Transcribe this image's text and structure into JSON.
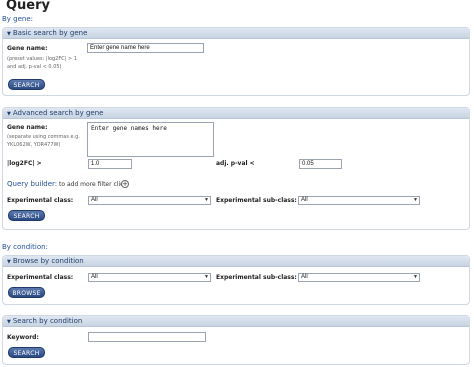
{
  "page_title": "Query",
  "by_gene_label": "By gene:",
  "by_condition_label": "By condition:",
  "basic": {
    "header": "Basic search by gene",
    "gene_name_label": "Gene name:",
    "hint": "(preset values: |log2FC| > 1 and adj. p-val < 0.05)",
    "gene_input_value": "Enter gene name here",
    "search_button": "SEARCH"
  },
  "advanced": {
    "header": "Advanced search by gene",
    "gene_name_label": "Gene name:",
    "hint": "(separate using commas e.g. YKL062W, YOR477W)",
    "gene_textarea_value": "Enter gene names here",
    "log2fc_label": "|log2FC| >",
    "log2fc_value": "1.0",
    "pval_label": "adj. p-val <",
    "pval_value": "0.05",
    "builder_title": "Query builder:",
    "builder_hint": " to add more filter click",
    "exp_class_label": "Experimental class:",
    "exp_class_value": "All",
    "exp_subclass_label": "Experimental sub-class:",
    "exp_subclass_value": "All",
    "search_button": "SEARCH"
  },
  "browse": {
    "header": "Browse by condition",
    "exp_class_label": "Experimental class:",
    "exp_class_value": "All",
    "exp_subclass_label": "Experimental sub-class:",
    "exp_subclass_value": "All",
    "browse_button": "BROWSE"
  },
  "search_condition": {
    "header": "Search by condition",
    "keyword_label": "Keyword:",
    "keyword_value": "",
    "search_button": "SEARCH"
  }
}
